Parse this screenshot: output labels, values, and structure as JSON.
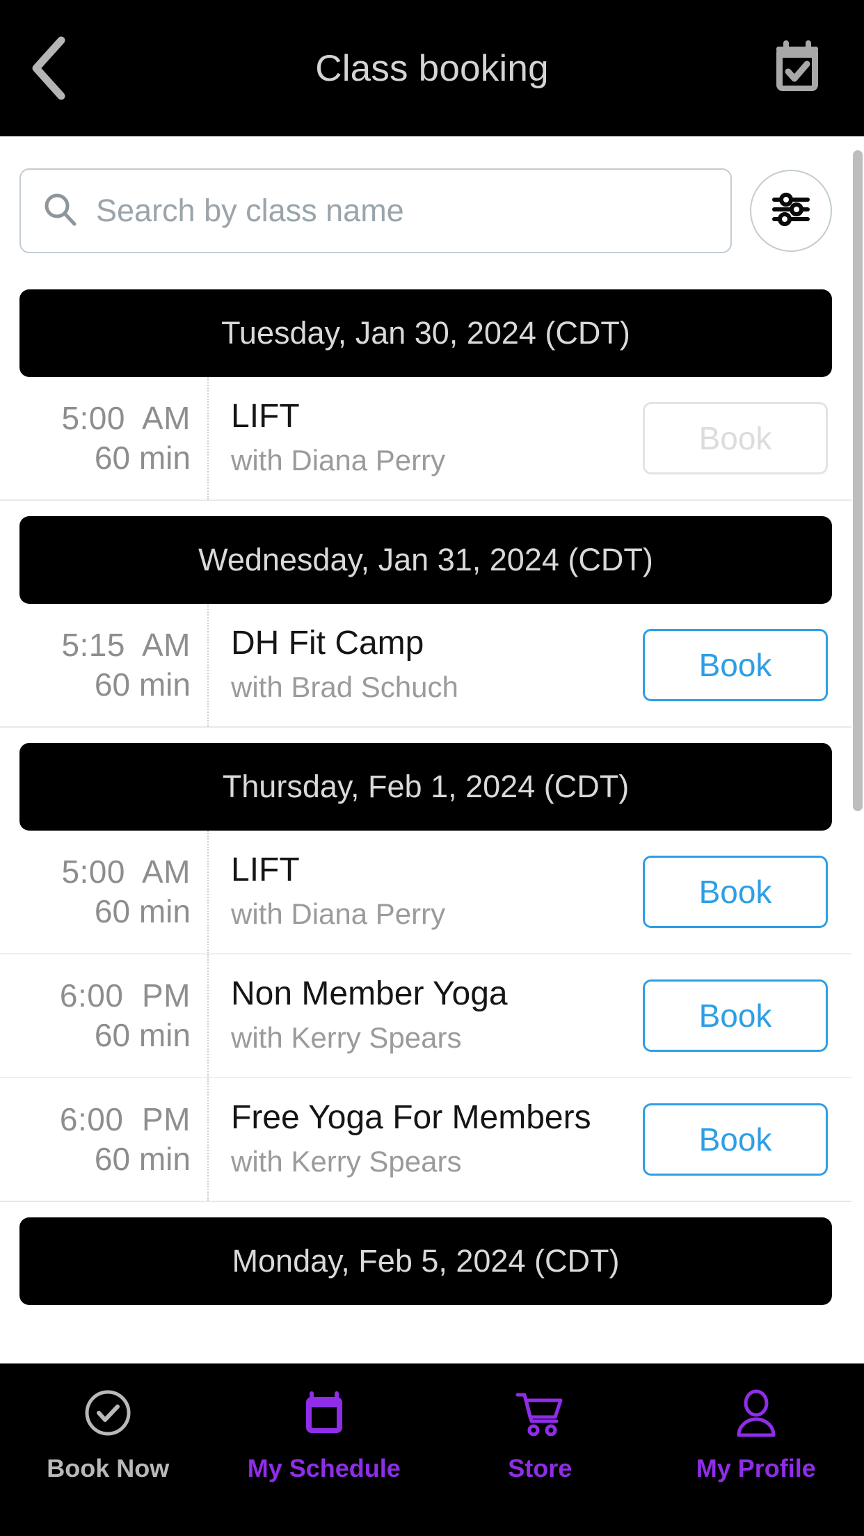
{
  "header": {
    "title": "Class booking",
    "back_icon": "chevron-left-icon",
    "calendar_icon": "calendar-check-icon"
  },
  "search": {
    "placeholder": "Search by class name",
    "value": "",
    "search_icon": "search-icon",
    "filter_icon": "sliders-filter-icon"
  },
  "colors": {
    "accent_blue": "#2d9fe5",
    "accent_purple": "#8f2de8",
    "header_bg": "#000000",
    "disabled_gray": "#dcdcdc"
  },
  "days": [
    {
      "date_label": "Tuesday, Jan 30, 2024 (CDT)",
      "classes": [
        {
          "time": "5:00  AM",
          "duration": "60 min",
          "name": "LIFT",
          "instructor": "with Diana Perry",
          "book_label": "Book",
          "disabled": true
        }
      ]
    },
    {
      "date_label": "Wednesday, Jan 31, 2024 (CDT)",
      "classes": [
        {
          "time": "5:15  AM",
          "duration": "60 min",
          "name": "DH Fit Camp",
          "instructor": "with Brad Schuch",
          "book_label": "Book",
          "disabled": false
        }
      ]
    },
    {
      "date_label": "Thursday, Feb 1, 2024 (CDT)",
      "classes": [
        {
          "time": "5:00  AM",
          "duration": "60 min",
          "name": "LIFT",
          "instructor": "with Diana Perry",
          "book_label": "Book",
          "disabled": false
        },
        {
          "time": "6:00  PM",
          "duration": "60 min",
          "name": "Non Member Yoga",
          "instructor": "with Kerry Spears",
          "book_label": "Book",
          "disabled": false
        },
        {
          "time": "6:00  PM",
          "duration": "60 min",
          "name": "Free Yoga For Members",
          "instructor": "with Kerry Spears",
          "book_label": "Book",
          "disabled": false
        }
      ]
    },
    {
      "date_label": "Monday, Feb 5, 2024 (CDT)",
      "classes": []
    }
  ],
  "bottom_nav": [
    {
      "label": "Book Now",
      "icon": "check-circle-icon",
      "active": false
    },
    {
      "label": "My Schedule",
      "icon": "calendar-icon",
      "active": true
    },
    {
      "label": "Store",
      "icon": "shopping-cart-icon",
      "active": true
    },
    {
      "label": "My Profile",
      "icon": "person-icon",
      "active": true
    }
  ]
}
